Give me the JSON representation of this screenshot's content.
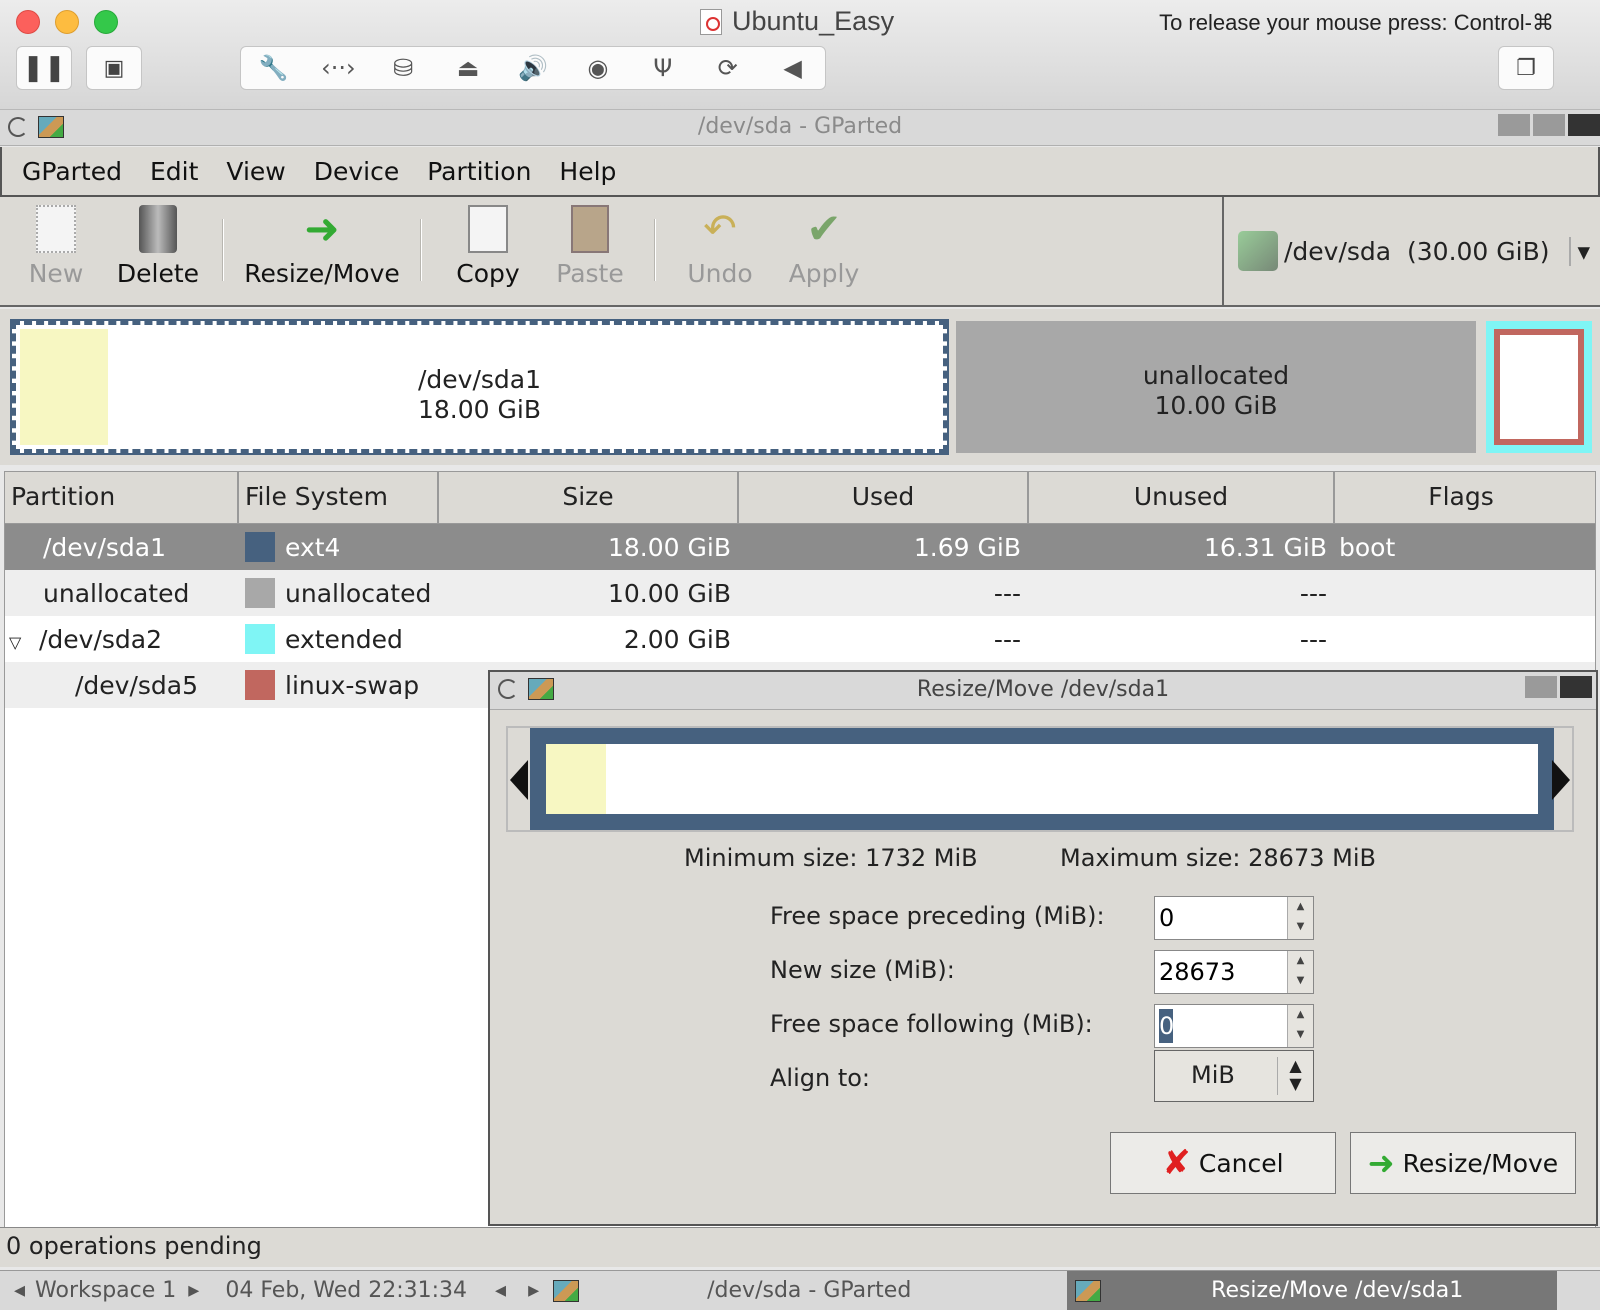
{
  "host": {
    "window_title": "Ubuntu_Easy",
    "release_hint": "To release your mouse press: Control-⌘"
  },
  "gparted": {
    "window_title": "/dev/sda - GParted",
    "menu": [
      "GParted",
      "Edit",
      "View",
      "Device",
      "Partition",
      "Help"
    ],
    "toolbar": {
      "new": "New",
      "delete": "Delete",
      "resize_move": "Resize/Move",
      "copy": "Copy",
      "paste": "Paste",
      "undo": "Undo",
      "apply": "Apply"
    },
    "device": "/dev/sda  (30.00 GiB)",
    "disk_map": {
      "sda1_name": "/dev/sda1",
      "sda1_size": "18.00 GiB",
      "unalloc_name": "unallocated",
      "unalloc_size": "10.00 GiB"
    },
    "columns": [
      "Partition",
      "File System",
      "Size",
      "Used",
      "Unused",
      "Flags"
    ],
    "rows": [
      {
        "partition": "/dev/sda1",
        "fs": "ext4",
        "size": "18.00 GiB",
        "used": "1.69 GiB",
        "unused": "16.31 GiB",
        "flags": "boot",
        "color": "#46617f"
      },
      {
        "partition": "unallocated",
        "fs": "unallocated",
        "size": "10.00 GiB",
        "used": "---",
        "unused": "---",
        "flags": "",
        "color": "#a8a8a8"
      },
      {
        "partition": "/dev/sda2",
        "fs": "extended",
        "size": "2.00 GiB",
        "used": "---",
        "unused": "---",
        "flags": "",
        "color": "#7ff5f5"
      },
      {
        "partition": "/dev/sda5",
        "fs": "linux-swap",
        "size": "",
        "used": "",
        "unused": "",
        "flags": "",
        "color": "#c1675f"
      }
    ],
    "status": "0 operations pending"
  },
  "dialog": {
    "title": "Resize/Move /dev/sda1",
    "min_size": "Minimum size: 1732 MiB",
    "max_size": "Maximum size: 28673 MiB",
    "preceding_label": "Free space preceding (MiB):",
    "preceding_value": "0",
    "newsize_label": "New size (MiB):",
    "newsize_value": "28673",
    "following_label": "Free space following (MiB):",
    "following_value": "0",
    "align_label": "Align to:",
    "align_value": "MiB",
    "cancel": "Cancel",
    "resize_move": "Resize/Move"
  },
  "taskbar": {
    "workspace": "Workspace 1",
    "datetime": "04 Feb, Wed 22:31:34",
    "task1": "/dev/sda - GParted",
    "task2": "Resize/Move /dev/sda1"
  }
}
